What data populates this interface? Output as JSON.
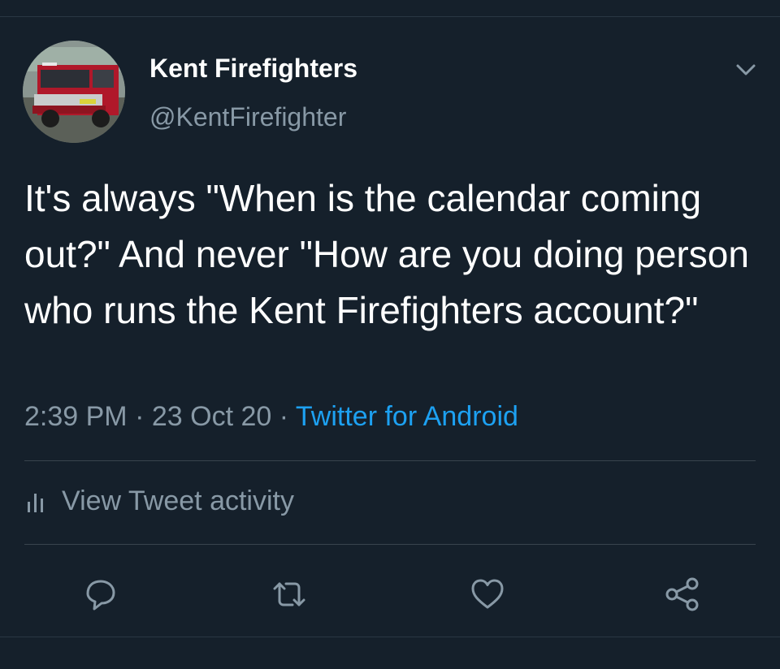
{
  "account": {
    "name": "Kent Firefighters",
    "handle": "@KentFirefighter"
  },
  "tweet": {
    "text": "It's always \"When is the calendar coming out?\" And never \"How are you doing person who runs the Kent Firefighters account?\"",
    "time": "2:39 PM",
    "date": "23 Oct 20",
    "separator": "·",
    "source": "Twitter for Android"
  },
  "activity": {
    "label": "View Tweet activity"
  },
  "icons": {
    "menu": "chevron-down-icon",
    "activity": "bar-chart-icon",
    "reply": "reply-icon",
    "retweet": "retweet-icon",
    "like": "heart-icon",
    "share": "share-icon"
  },
  "colors": {
    "background": "#15202b",
    "text_primary": "#ffffff",
    "text_secondary": "#8899a6",
    "link": "#1da1f2",
    "divider": "#38444d"
  }
}
